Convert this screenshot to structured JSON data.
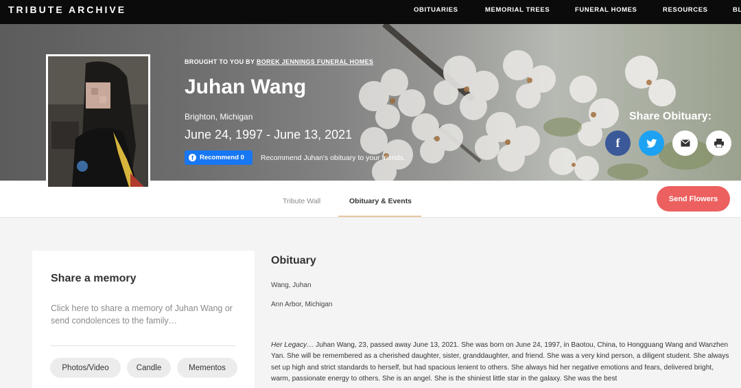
{
  "nav": {
    "brand": "TRIBUTE ARCHIVE",
    "items": [
      "OBITUARIES",
      "MEMORIAL TREES",
      "FUNERAL HOMES",
      "RESOURCES",
      "BL"
    ]
  },
  "hero": {
    "brought_prefix": "BROUGHT TO YOU BY",
    "brought_link": "BOREK JENNINGS FUNERAL HOMES",
    "name": "Juhan Wang",
    "location": "Brighton, Michigan",
    "dates": "June 24, 1997 - June 13, 2021",
    "recommend_label": "Recommend 0",
    "recommend_icon": "facebook-icon",
    "recommend_text": "Recommend Juhan's obituary to your friends.",
    "share_label": "Share Obituary:",
    "share_buttons": [
      {
        "icon": "facebook-icon",
        "glyph": "f",
        "color": "#3b5998"
      },
      {
        "icon": "twitter-icon",
        "glyph": "🐦",
        "color": "#1da1f2"
      },
      {
        "icon": "email-icon",
        "glyph": "✉",
        "color": "#ffffff"
      },
      {
        "icon": "print-icon",
        "glyph": "⎙",
        "color": "#ffffff"
      }
    ]
  },
  "tabs": {
    "tribute_wall": "Tribute Wall",
    "obituary_events": "Obituary & Events",
    "send_flowers": "Send Flowers"
  },
  "memory": {
    "title": "Share a memory",
    "prompt": "Click here to share a memory of Juhan Wang or send condolences to the family…",
    "buttons": [
      "Photos/Video",
      "Candle",
      "Mementos"
    ]
  },
  "obituary": {
    "title": "Obituary",
    "name_line": "Wang, Juhan",
    "city_line": "Ann Arbor, Michigan",
    "legacy_label": "Her Legacy…",
    "body": " Juhan Wang, 23, passed away June 13, 2021.  She was born on June 24, 1997, in Baotou, China, to Hongguang Wang and Wanzhen Yan.  She will be remembered as a cherished daughter, sister, granddaughter, and friend. She was a very kind person, a diligent student. She always set up high and strict standards to herself, but had spacious lenient to others. She always hid her negative emotions and fears, delivered bright, warm, passionate energy to others. She is an angel. She is the shiniest little star in the galaxy. She was the best"
  },
  "colors": {
    "send_flowers": "#ec6060",
    "tab_underline": "#e8c79a",
    "recommend_button": "#1877f2"
  }
}
